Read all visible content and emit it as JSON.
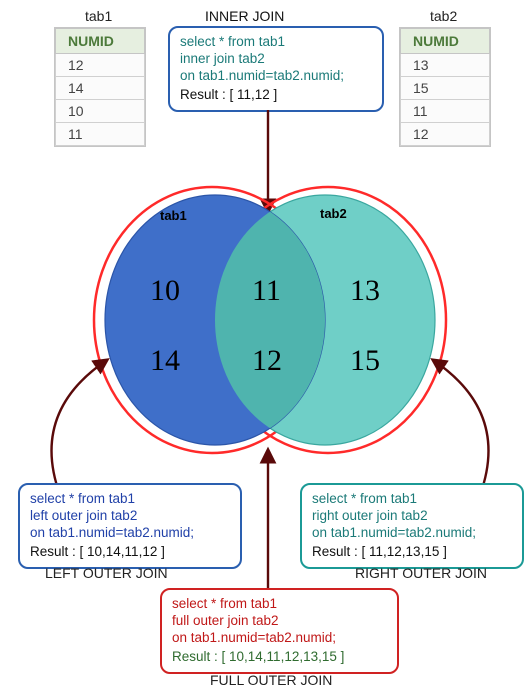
{
  "labels": {
    "tab1": "tab1",
    "tab2": "tab2",
    "inner_title": "INNER JOIN",
    "left_title": "LEFT OUTER JOIN",
    "right_title": "RIGHT OUTER JOIN",
    "full_title": "FULL OUTER JOIN",
    "col_header": "NUMID"
  },
  "tables": {
    "tab1_rows": [
      "12",
      "14",
      "10",
      "11"
    ],
    "tab2_rows": [
      "13",
      "15",
      "11",
      "12"
    ]
  },
  "venn": {
    "left_label": "tab1",
    "right_label": "tab2",
    "left_only": [
      "10",
      "14"
    ],
    "intersection": [
      "11",
      "12"
    ],
    "right_only": [
      "13",
      "15"
    ]
  },
  "sql": {
    "inner": {
      "query": "select * from tab1\ninner join tab2\non tab1.numid=tab2.numid;",
      "result": "Result : [ 11,12 ]"
    },
    "left": {
      "query": "select * from tab1\nleft outer join tab2\non tab1.numid=tab2.numid;",
      "result": "Result : [ 10,14,11,12 ]"
    },
    "right": {
      "query": "select * from tab1\nright outer join tab2\non tab1.numid=tab2.numid;",
      "result": "Result : [ 11,12,13,15 ]"
    },
    "full": {
      "query": "select * from tab1\nfull outer join tab2\non tab1.numid=tab2.numid;",
      "result": "Result : [ 10,14,11,12,13,15 ]"
    }
  },
  "chart_data": {
    "type": "venn",
    "sets": [
      {
        "name": "tab1",
        "values": [
          12,
          14,
          10,
          11
        ]
      },
      {
        "name": "tab2",
        "values": [
          13,
          15,
          11,
          12
        ]
      }
    ],
    "regions": {
      "tab1_only": [
        10,
        14
      ],
      "intersection": [
        11,
        12
      ],
      "tab2_only": [
        13,
        15
      ]
    },
    "joins": {
      "inner": [
        11,
        12
      ],
      "left_outer": [
        10,
        14,
        11,
        12
      ],
      "right_outer": [
        11,
        12,
        13,
        15
      ],
      "full_outer": [
        10,
        14,
        11,
        12,
        13,
        15
      ]
    }
  }
}
